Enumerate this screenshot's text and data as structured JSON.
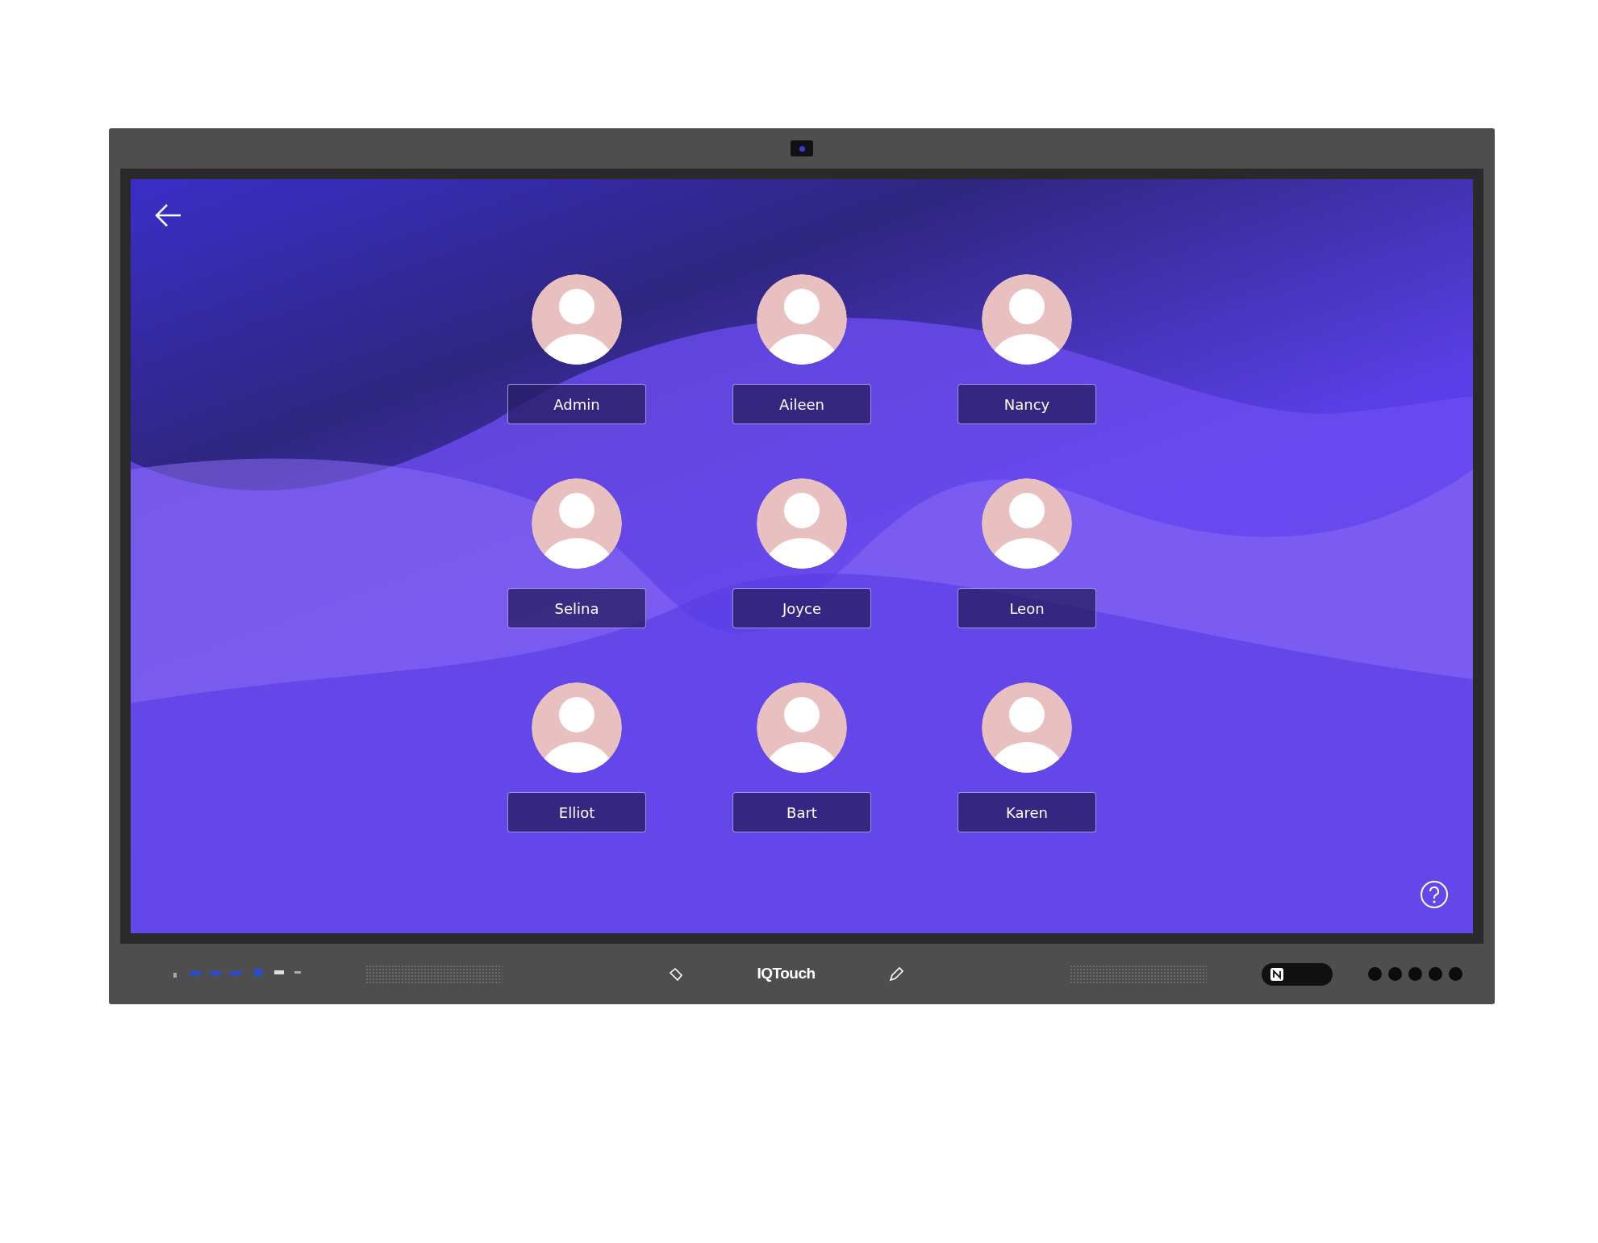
{
  "screen": {
    "users": [
      {
        "name": "Admin"
      },
      {
        "name": "Aileen"
      },
      {
        "name": "Nancy"
      },
      {
        "name": "Selina"
      },
      {
        "name": "Joyce"
      },
      {
        "name": "Leon"
      },
      {
        "name": "Elliot"
      },
      {
        "name": "Bart"
      },
      {
        "name": "Karen"
      }
    ]
  },
  "bezel": {
    "logo": "IQTouch"
  }
}
